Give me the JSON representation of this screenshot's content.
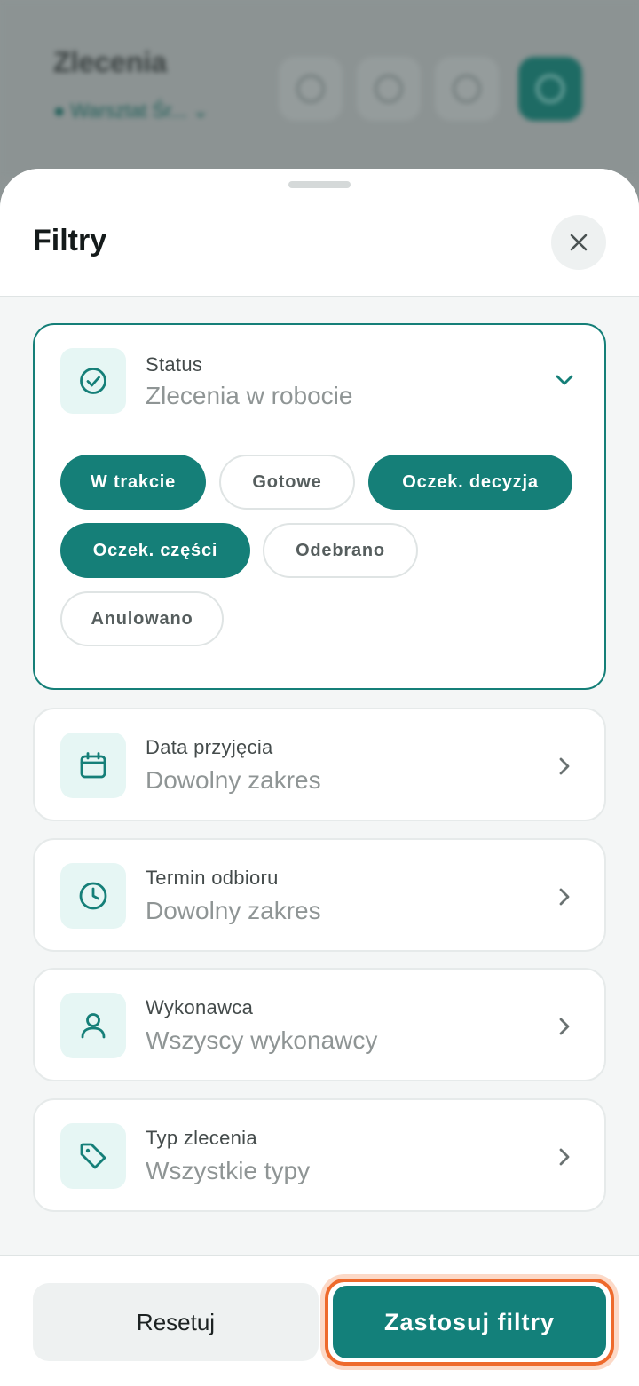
{
  "background": {
    "title": "Zlecenia",
    "subtitle": "● Warsztat Śr... ⌄",
    "icons": [
      "bell-icon",
      "calendar-icon",
      "filter-icon",
      "add-icon"
    ]
  },
  "sheet": {
    "title": "Filtry",
    "close_icon": "close-icon"
  },
  "status": {
    "label": "Status",
    "value": "Zlecenia w robocie",
    "icon": "check-circle-icon",
    "chips": [
      {
        "label": "W trakcie",
        "selected": true
      },
      {
        "label": "Gotowe",
        "selected": false
      },
      {
        "label": "Oczek. decyzja",
        "selected": true
      },
      {
        "label": "Oczek. części",
        "selected": true
      },
      {
        "label": "Odebrano",
        "selected": false
      },
      {
        "label": "Anulowano",
        "selected": false
      }
    ]
  },
  "filters": [
    {
      "label": "Data przyjęcia",
      "value": "Dowolny zakres",
      "icon": "calendar-icon"
    },
    {
      "label": "Termin odbioru",
      "value": "Dowolny zakres",
      "icon": "clock-icon"
    },
    {
      "label": "Wykonawca",
      "value": "Wszyscy wykonawcy",
      "icon": "user-icon"
    },
    {
      "label": "Typ zlecenia",
      "value": "Wszystkie typy",
      "icon": "tag-icon"
    }
  ],
  "footer": {
    "reset_label": "Resetuj",
    "apply_label": "Zastosuj filtry"
  },
  "colors": {
    "accent": "#157f78",
    "highlight": "#ee6a2c"
  }
}
